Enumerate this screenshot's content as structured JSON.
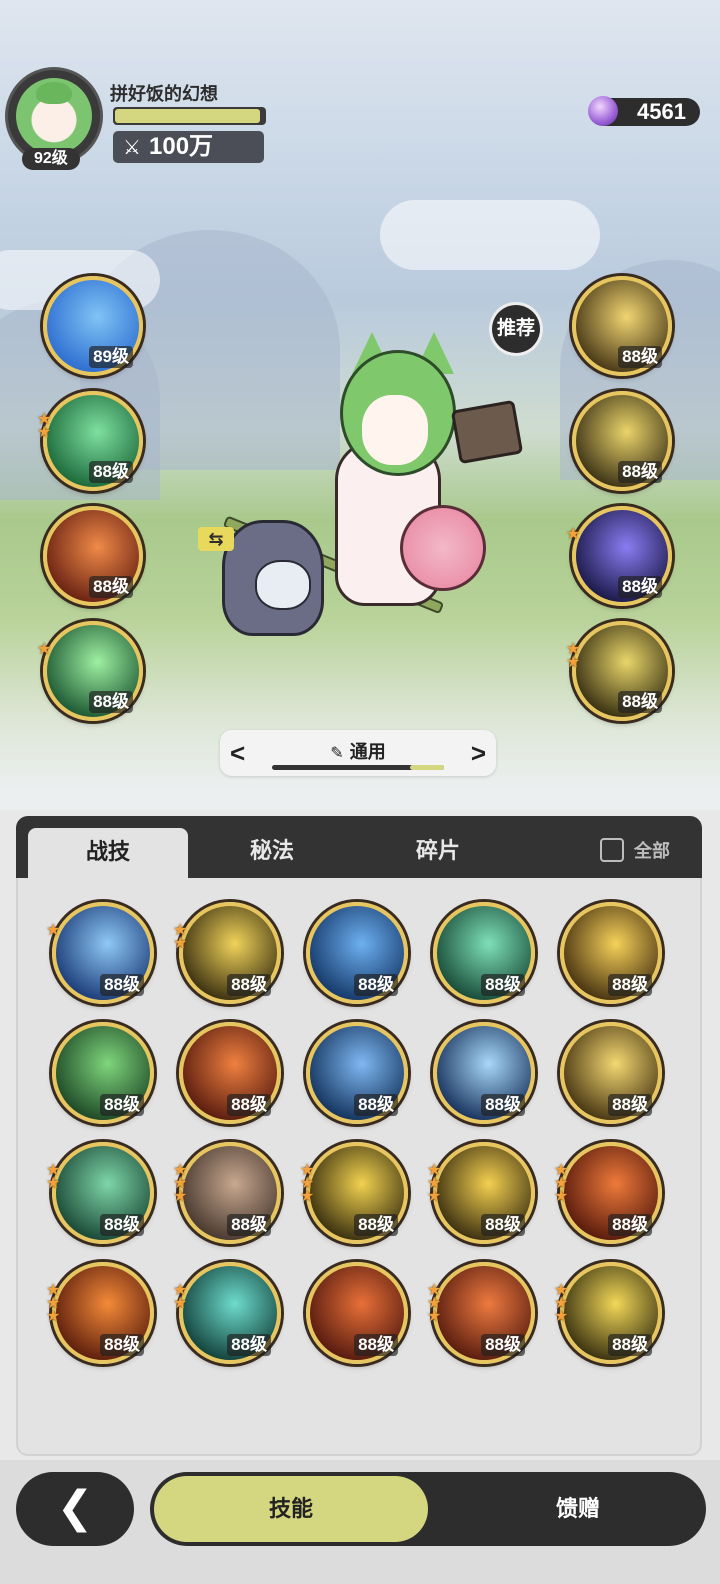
{
  "player": {
    "name": "拼好饭的幻想",
    "level_label": "92级",
    "exp_fraction": 0.97,
    "power_label": "100万",
    "power_icon": "sword-cross-icon"
  },
  "currency": {
    "value": "4561",
    "icon": "purple-gem-icon"
  },
  "recommend_label": "推荐",
  "equipped_left": [
    {
      "icon": "blue-vortex-skill",
      "level": "89级",
      "stars": 0,
      "colors": [
        "#2f6fd1",
        "#7fc4f5"
      ]
    },
    {
      "icon": "green-sphere-skill",
      "level": "88级",
      "stars": 2,
      "colors": [
        "#1e6b3c",
        "#7ee0a0"
      ]
    },
    {
      "icon": "fire-meteor-skill",
      "level": "88级",
      "stars": 0,
      "colors": [
        "#6b2414",
        "#f08a48"
      ]
    },
    {
      "icon": "green-wind-skill",
      "level": "88级",
      "stars": 1,
      "colors": [
        "#1f5a34",
        "#9ef0a2"
      ]
    }
  ],
  "equipped_right": [
    {
      "icon": "golden-burst-skill",
      "level": "88级",
      "stars": 0,
      "colors": [
        "#4a3a18",
        "#f1d572"
      ]
    },
    {
      "icon": "golden-arrow-skill",
      "level": "88级",
      "stars": 0,
      "colors": [
        "#3f3518",
        "#ead46a"
      ]
    },
    {
      "icon": "arcane-clock-skill",
      "level": "88级",
      "stars": 1,
      "colors": [
        "#1c1a4a",
        "#8a7cf2"
      ]
    },
    {
      "icon": "golden-spirit-skill",
      "level": "88级",
      "stars": 2,
      "colors": [
        "#3a3214",
        "#e9d66a"
      ]
    }
  ],
  "preset": {
    "name": "通用",
    "icon": "pencil-icon",
    "prev_icon": "chevron-left-icon",
    "next_icon": "chevron-right-icon"
  },
  "tabs": [
    {
      "label": "战技",
      "active": true
    },
    {
      "label": "秘法",
      "active": false
    },
    {
      "label": "碎片",
      "active": false
    }
  ],
  "show_all_label": "全部",
  "skill_grid": [
    {
      "icon": "ice-shatter-skill",
      "level": "88级",
      "stars": 1,
      "colors": [
        "#1d3e7a",
        "#8fc8f6"
      ]
    },
    {
      "icon": "golden-diamond-skill",
      "level": "88级",
      "stars": 2,
      "colors": [
        "#3e3312",
        "#f0d35a"
      ]
    },
    {
      "icon": "water-wave-skill",
      "level": "88级",
      "stars": 0,
      "colors": [
        "#163a6b",
        "#6db0f0"
      ]
    },
    {
      "icon": "jade-wind-skill",
      "level": "88级",
      "stars": 0,
      "colors": [
        "#1a4d3a",
        "#7ee0b8"
      ]
    },
    {
      "icon": "golden-explosion-skill",
      "level": "88级",
      "stars": 0,
      "colors": [
        "#4a3512",
        "#f6d15a"
      ]
    },
    {
      "icon": "green-heal-skill",
      "level": "88级",
      "stars": 0,
      "colors": [
        "#1f4a28",
        "#7fd67c"
      ]
    },
    {
      "icon": "fire-orb-skill",
      "level": "88级",
      "stars": 0,
      "colors": [
        "#5c1e10",
        "#ef8040"
      ]
    },
    {
      "icon": "ice-crystal-skill",
      "level": "88级",
      "stars": 0,
      "colors": [
        "#15355f",
        "#7fb8f2"
      ]
    },
    {
      "icon": "ice-spikes-skill",
      "level": "88级",
      "stars": 0,
      "colors": [
        "#1a3560",
        "#a8d8f8"
      ]
    },
    {
      "icon": "golden-star-skill",
      "level": "88级",
      "stars": 0,
      "colors": [
        "#4a3814",
        "#f4d872"
      ]
    },
    {
      "icon": "thorn-vine-skill",
      "level": "88级",
      "stars": 2,
      "colors": [
        "#1c4a38",
        "#7ed6a8"
      ]
    },
    {
      "icon": "stone-card-skill",
      "level": "88级",
      "stars": 3,
      "colors": [
        "#4a3a30",
        "#c8a890"
      ]
    },
    {
      "icon": "golden-lightning-skill",
      "level": "88级",
      "stars": 3,
      "colors": [
        "#3c3210",
        "#f2d250"
      ]
    },
    {
      "icon": "golden-sun-skill",
      "level": "88级",
      "stars": 3,
      "colors": [
        "#3e3212",
        "#f4d050"
      ]
    },
    {
      "icon": "fire-spiral-skill",
      "level": "88级",
      "stars": 3,
      "colors": [
        "#5a1c0e",
        "#ee7a3a"
      ]
    },
    {
      "icon": "flame-burst-skill",
      "level": "88级",
      "stars": 3,
      "colors": [
        "#5e200e",
        "#f48a38"
      ]
    },
    {
      "icon": "teal-whirlpool-skill",
      "level": "88级",
      "stars": 2,
      "colors": [
        "#14443e",
        "#6edccc"
      ]
    },
    {
      "icon": "fire-ring-skill",
      "level": "88级",
      "stars": 0,
      "colors": [
        "#581c10",
        "#e87038"
      ]
    },
    {
      "icon": "fire-wave-skill",
      "level": "88级",
      "stars": 3,
      "colors": [
        "#5a1e10",
        "#ee7a40"
      ]
    },
    {
      "icon": "golden-cat-skill",
      "level": "88级",
      "stars": 3,
      "colors": [
        "#3c3412",
        "#f2d858"
      ]
    }
  ],
  "bottom_nav": {
    "back_icon": "back-arrow-icon",
    "skills_label": "技能",
    "gifts_label": "馈赠"
  }
}
